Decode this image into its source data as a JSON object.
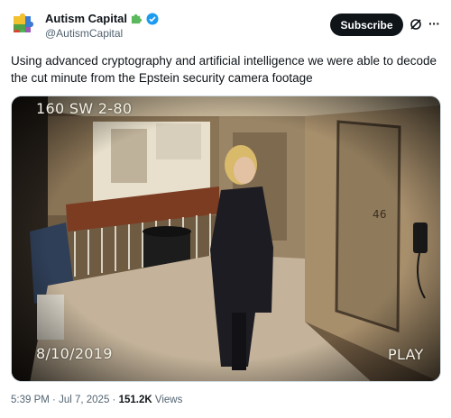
{
  "author": {
    "display_name": "Autism Capital",
    "handle": "@AutismCapital",
    "badge_icon": "puzzle-piece-icon",
    "verified_icon": "verified-badge-icon",
    "verified_color": "#1d9bf0"
  },
  "actions": {
    "subscribe_label": "Subscribe",
    "grok_icon": "grok-icon",
    "more_icon": "more-icon"
  },
  "tweet": {
    "text": "Using advanced cryptography and artificial intelligence we were able to decode the cut minute from the Epstein security camera footage"
  },
  "media": {
    "camera_label": "160 SW 2-80",
    "date_label": "8/10/2019",
    "playback_label": "PLAY",
    "door_number": "46"
  },
  "meta": {
    "time": "5:39 PM",
    "separator": "·",
    "date": "Jul 7, 2025",
    "views_count": "151.2K",
    "views_label": "Views"
  }
}
